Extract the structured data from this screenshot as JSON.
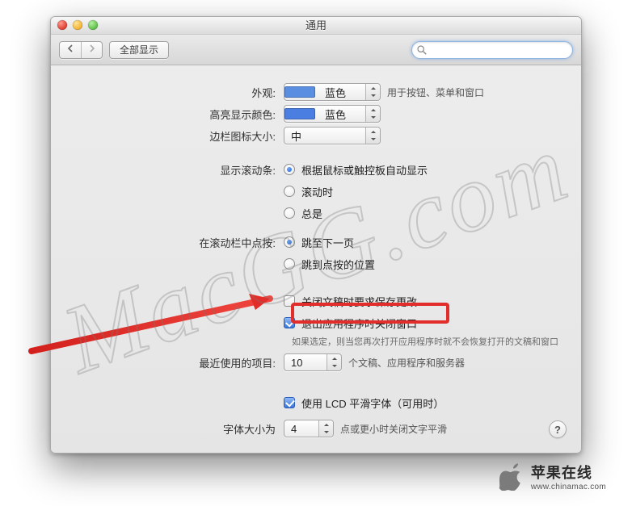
{
  "window": {
    "title": "通用",
    "show_all": "全部显示",
    "search_placeholder": ""
  },
  "appearance": {
    "label": "外观:",
    "value": "蓝色",
    "hint": "用于按钮、菜单和窗口"
  },
  "highlight": {
    "label": "高亮显示颜色:",
    "value": "蓝色"
  },
  "sidebar_size": {
    "label": "边栏图标大小:",
    "value": "中"
  },
  "scrollbars": {
    "label": "显示滚动条:",
    "options": [
      "根据鼠标或触控板自动显示",
      "滚动时",
      "总是"
    ],
    "selected": 0
  },
  "scroll_click": {
    "label": "在滚动栏中点按:",
    "options": [
      "跳至下一页",
      "跳到点按的位置"
    ],
    "selected": 0
  },
  "close_save": {
    "label": "关闭文稿时要求保存更改",
    "checked": false
  },
  "quit_close": {
    "label": "退出应用程序时关闭窗口",
    "checked": true,
    "hint": "如果选定，则当您再次打开应用程序时就不会恢复打开的文稿和窗口"
  },
  "recent": {
    "label": "最近使用的项目:",
    "value": "10",
    "after": "个文稿、应用程序和服务器"
  },
  "lcd": {
    "label": "使用 LCD 平滑字体（可用时）",
    "checked": true
  },
  "font_size": {
    "label": "字体大小为",
    "value": "4",
    "after": "点或更小时关闭文字平滑"
  },
  "help": "?",
  "watermark": "MacGG.com",
  "brand": {
    "cn": "苹果在线",
    "url": "www.chinamac.com"
  }
}
